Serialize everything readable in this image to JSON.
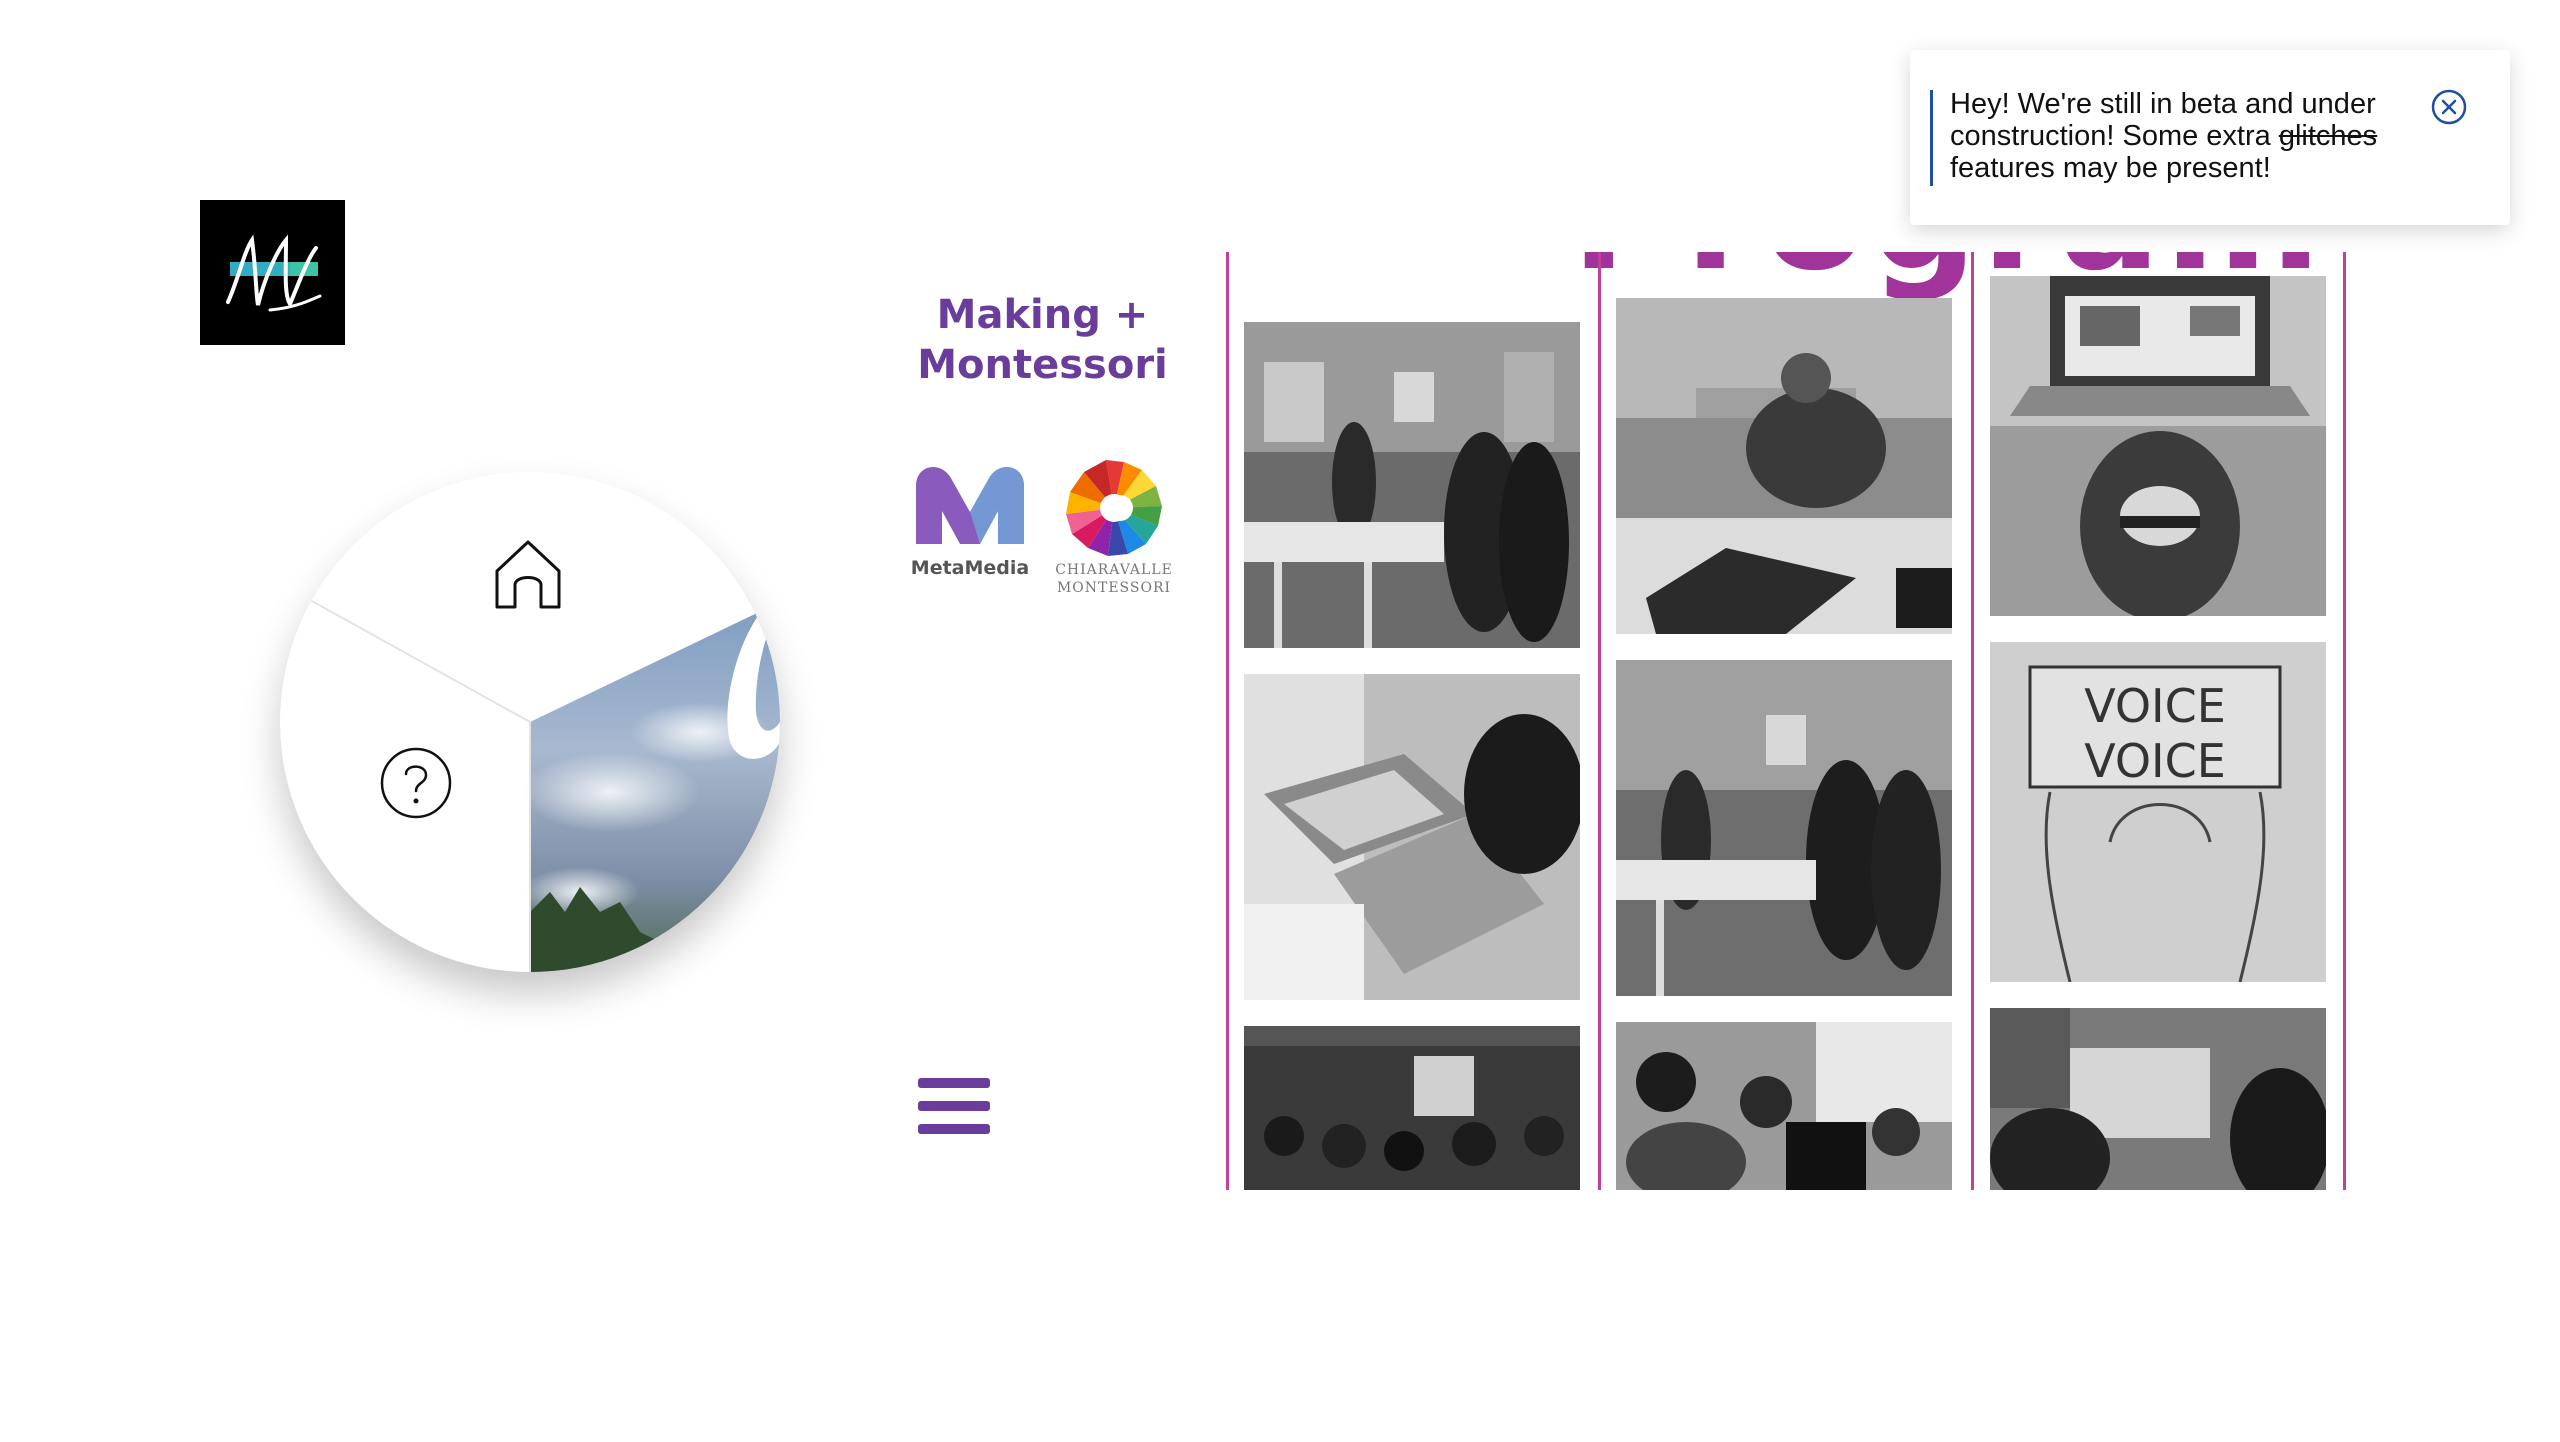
{
  "sidebar": {
    "title_line1": "Making +",
    "title_line2": "Montessori",
    "metamedia_label": "MetaMedia",
    "chiaravalle_line1": "CHIARAVALLE",
    "chiaravalle_line2": "MONTESSORI"
  },
  "circle_menu": {
    "items": [
      {
        "icon": "home-icon"
      },
      {
        "icon": "help-icon"
      }
    ]
  },
  "program": {
    "title": "Program"
  },
  "beta_notice": {
    "text_before": "Hey! We're still in beta and under construction! Some extra ",
    "struck_word": "glitches",
    "text_after": " features may be present!"
  },
  "colors": {
    "brand_purple": "#6a3d9a",
    "program_magenta": "#a0349a",
    "divider_pink": "#c0409a",
    "notice_blue": "#1f4fa0"
  }
}
